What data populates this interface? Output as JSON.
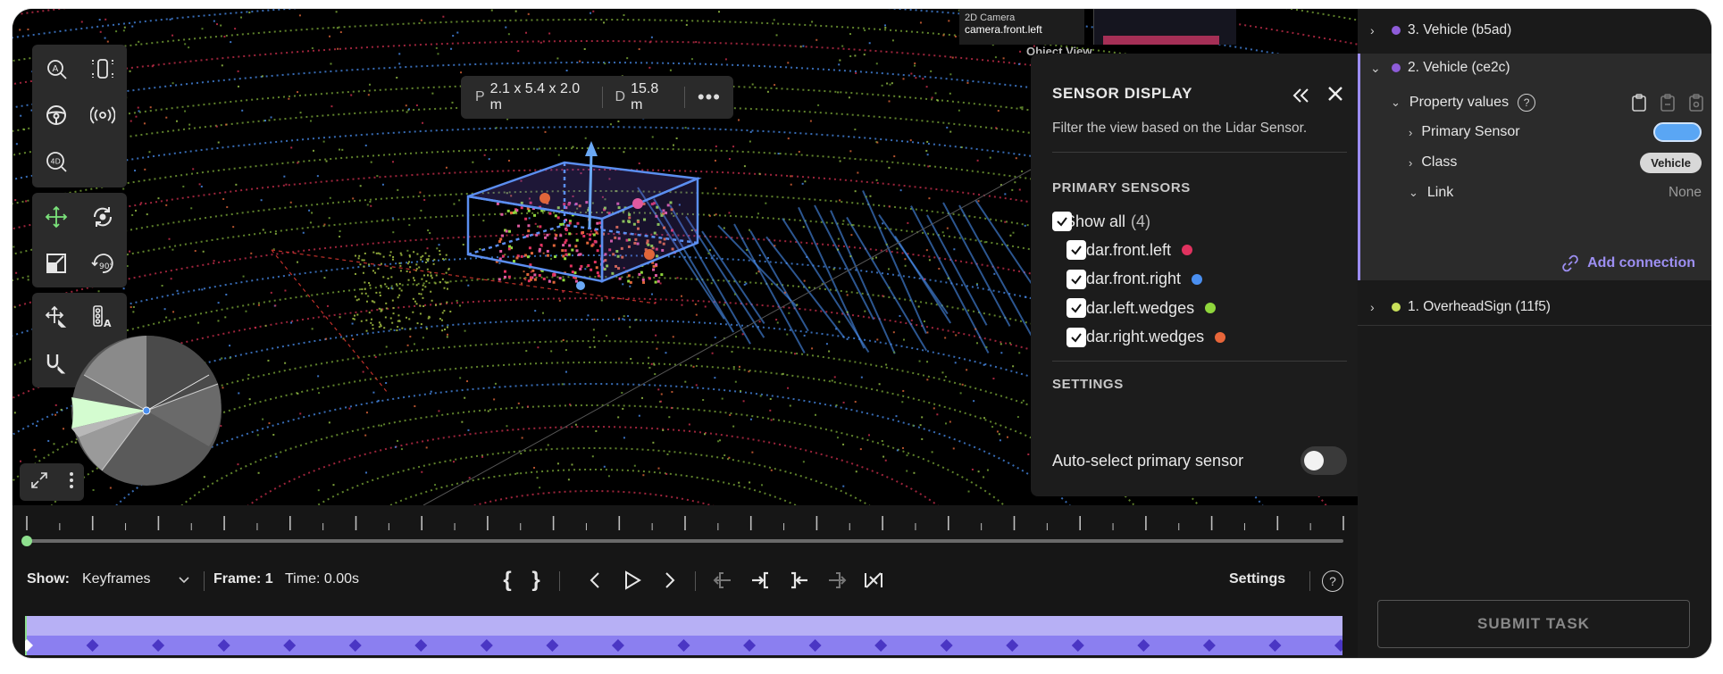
{
  "toolbar": {
    "groups": [
      {
        "buttons": [
          "auto-label-icon",
          "vehicle-top-icon",
          "steering-wheel-icon",
          "sensor-fusion-icon",
          "4d-icon"
        ]
      },
      {
        "buttons": [
          "move-icon",
          "rotate-icon",
          "scale-icon",
          "rotate-90-icon"
        ]
      },
      {
        "buttons": [
          "move-arrows-icon",
          "traffic-light-icon",
          "magnet-icon"
        ]
      }
    ],
    "rotate90_label": "90°",
    "fourd_label": "4D"
  },
  "dimension": {
    "p_label": "P",
    "p_value": "2.1 x 5.4 x 2.0 m",
    "d_label": "D",
    "d_value": "15.8 m",
    "more": "•••"
  },
  "camera": {
    "title": "2D Camera",
    "name": "camera.front.left",
    "object_view": "Object View"
  },
  "sensor_panel": {
    "title": "SENSOR DISPLAY",
    "description": "Filter the view based on the Lidar Sensor.",
    "primary_header": "PRIMARY SENSORS",
    "show_all_label": "Show all",
    "show_all_count": "(4)",
    "sensors": [
      {
        "name": "lidar.front.left",
        "color": "#e0325f"
      },
      {
        "name": "lidar.front.right",
        "color": "#4a8ff0"
      },
      {
        "name": "lidar.left.wedges",
        "color": "#8fd63c"
      },
      {
        "name": "lidar.right.wedges",
        "color": "#e8663a"
      }
    ],
    "settings_header": "SETTINGS",
    "auto_select_label": "Auto-select primary sensor",
    "auto_select_on": false
  },
  "objects": {
    "top": {
      "label": "3. Vehicle (b5ad)",
      "color": "#8e5cd9"
    },
    "selected": {
      "label": "2. Vehicle (ce2c)",
      "color": "#8e5cd9"
    },
    "property_values_label": "Property values",
    "properties": [
      {
        "label": "Primary Sensor",
        "value": ""
      },
      {
        "label": "Class",
        "value": "Vehicle"
      },
      {
        "label": "Link",
        "value": "None"
      }
    ],
    "add_connection": "Add connection",
    "bottom": {
      "label": "1. OverheadSign (11f5)",
      "color": "#c9e05a"
    }
  },
  "submit_label": "SUBMIT TASK",
  "timeline": {
    "show_label": "Show:",
    "show_value": "Keyframes",
    "frame_label": "Frame: 1",
    "time_label": "Time: 0.00s",
    "settings_label": "Settings",
    "help": "?",
    "progress": 0.0,
    "keyframe_count": 21,
    "band_color": "#b7b0f5",
    "keyframe_color": "#4a36c4"
  }
}
